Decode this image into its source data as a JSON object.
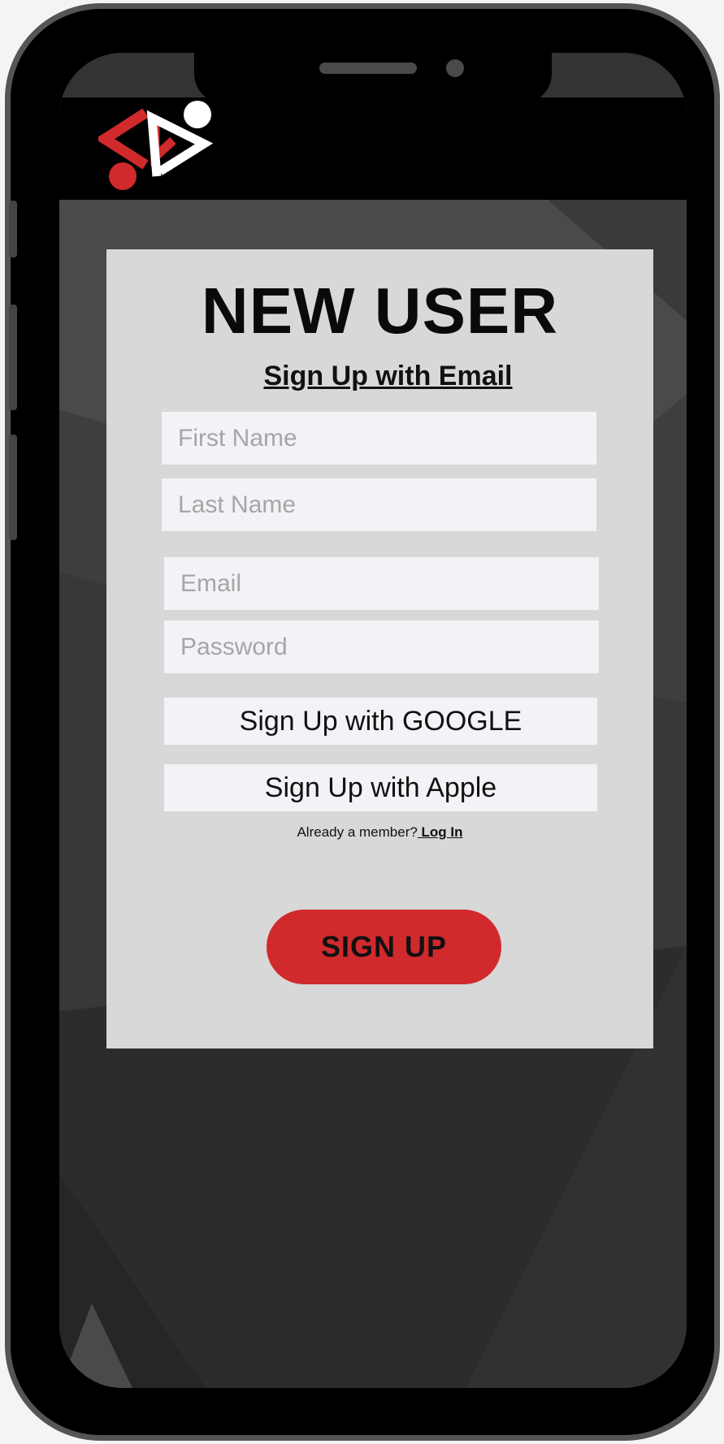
{
  "colors": {
    "accent": "#d02a2c",
    "card_background": "#d8d8d8",
    "field_background": "#f2f3f7",
    "placeholder": "#a6a6a6",
    "header": "#000000",
    "screen_background": "#333333"
  },
  "header": {
    "logo_icon": "brand-logo-icon"
  },
  "form": {
    "title": "NEW USER",
    "subtitle": "Sign Up with Email",
    "fields": {
      "first_name": {
        "placeholder": "First Name",
        "value": ""
      },
      "last_name": {
        "placeholder": "Last Name",
        "value": ""
      },
      "email": {
        "placeholder": "Email",
        "value": ""
      },
      "password": {
        "placeholder": "Password",
        "value": ""
      }
    },
    "google_button": "Sign Up with GOOGLE",
    "apple_button": "Sign Up with Apple",
    "member_prompt": "Already a member?",
    "login_link": " Log In",
    "submit_button": "SIGN UP"
  }
}
